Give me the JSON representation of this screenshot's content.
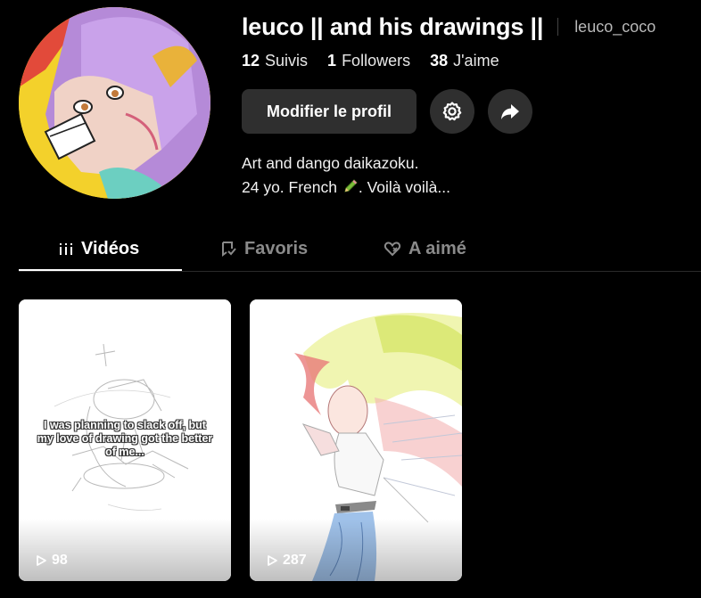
{
  "profile": {
    "display_name": "leuco || and his drawings ||",
    "username": "leuco_coco",
    "stats": [
      {
        "value": "12",
        "label": "Suivis"
      },
      {
        "value": "1",
        "label": "Followers"
      },
      {
        "value": "38",
        "label": "J'aime"
      }
    ],
    "edit_button": "Modifier le profil",
    "bio_line1": "Art and dango daikazoku.",
    "bio_line2_start": "24 yo. French",
    "bio_line2_end": ". Voilà voilà..."
  },
  "tabs": [
    {
      "label": "Vidéos",
      "icon": "grid-bars-icon",
      "active": true
    },
    {
      "label": "Favoris",
      "icon": "bookmark-icon",
      "active": false
    },
    {
      "label": "A aimé",
      "icon": "heart-icon",
      "active": false
    }
  ],
  "videos": [
    {
      "overlay_text": "I was planning to slack off, but my love of drawing got the better of me...",
      "views": "98"
    },
    {
      "overlay_text": "",
      "views": "287"
    }
  ],
  "colors": {
    "background": "#000000",
    "button": "#2f2f2f",
    "muted_text": "#8a8a8a",
    "avatar_background": "#f3d12b"
  }
}
